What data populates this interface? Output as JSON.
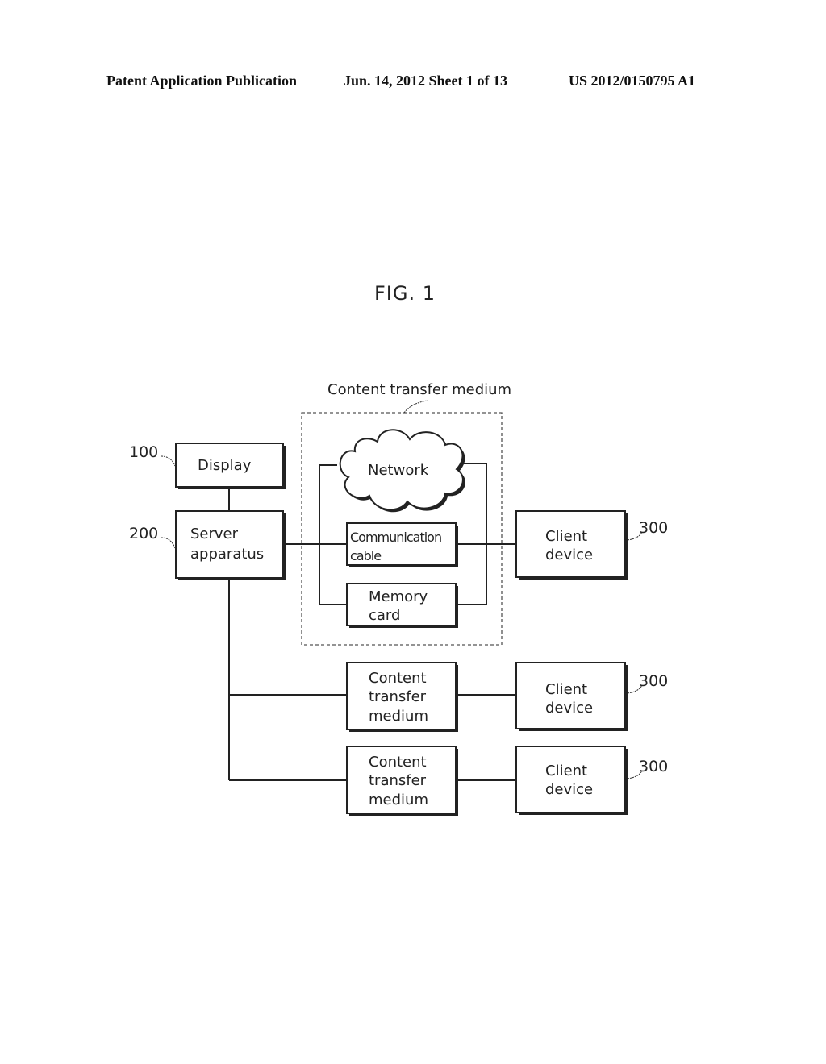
{
  "header": {
    "publication": "Patent Application Publication",
    "date_sheet": "Jun. 14, 2012  Sheet 1 of 13",
    "number": "US 2012/0150795 A1"
  },
  "figure": {
    "title": "FIG. 1",
    "group_label": "Content transfer medium",
    "nodes": {
      "display": {
        "ref": "100",
        "lines": [
          "Display"
        ]
      },
      "server": {
        "ref": "200",
        "lines": [
          "Server",
          "apparatus"
        ]
      },
      "network": {
        "lines": [
          "Network"
        ]
      },
      "cable": {
        "lines": [
          "Communication",
          "cable"
        ]
      },
      "memory": {
        "lines": [
          "Memory",
          "card"
        ]
      },
      "client1": {
        "ref": "300",
        "lines": [
          "Client",
          "device"
        ]
      },
      "medium2": {
        "lines": [
          "Content",
          "transfer",
          "medium"
        ]
      },
      "client2": {
        "ref": "300",
        "lines": [
          "Client",
          "device"
        ]
      },
      "medium3": {
        "lines": [
          "Content",
          "transfer",
          "medium"
        ]
      },
      "client3": {
        "ref": "300",
        "lines": [
          "Client",
          "device"
        ]
      }
    }
  }
}
